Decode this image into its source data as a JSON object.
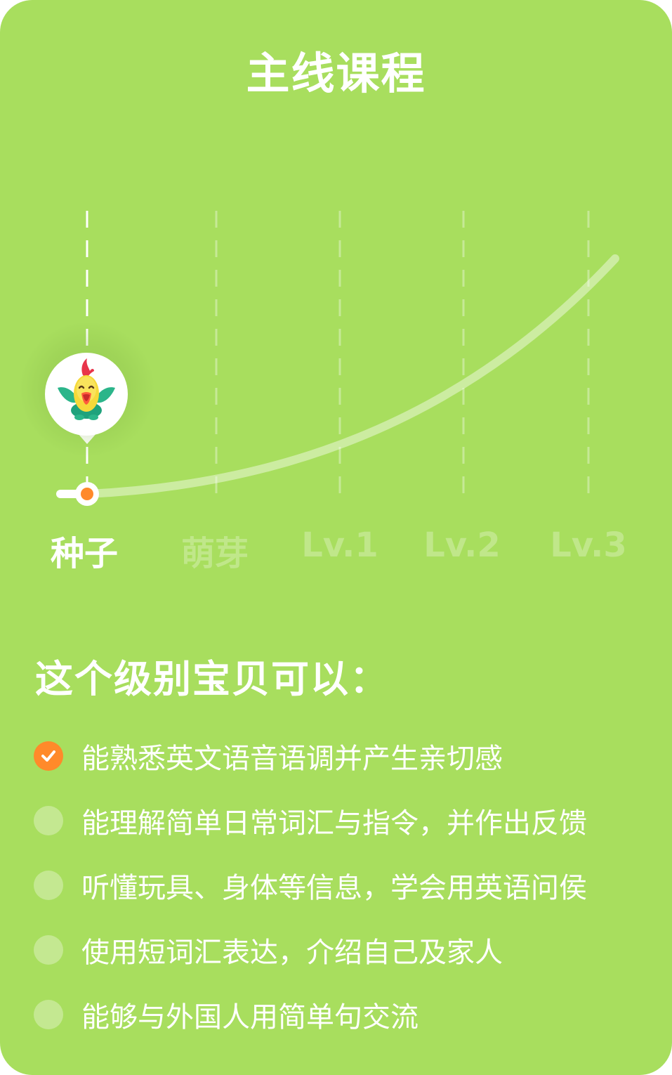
{
  "title": "主线课程",
  "progress": {
    "levels": [
      {
        "label": "种子",
        "current": true
      },
      {
        "label": "萌芽",
        "current": false
      },
      {
        "label": "Lv.1",
        "current": false
      },
      {
        "label": "Lv.2",
        "current": false
      },
      {
        "label": "Lv.3",
        "current": false
      }
    ],
    "avatar_icon": "rooster-mascot-icon"
  },
  "abilities": {
    "heading": "这个级别宝贝可以：",
    "items": [
      {
        "text": "能熟悉英文语音语调并产生亲切感",
        "done": true
      },
      {
        "text": "能理解简单日常词汇与指令，并作出反馈",
        "done": false
      },
      {
        "text": "听懂玩具、身体等信息，学会用英语问侯",
        "done": false
      },
      {
        "text": "使用短词汇表达，介绍自己及家人",
        "done": false
      },
      {
        "text": "能够与外国人用简单句交流",
        "done": false
      }
    ]
  },
  "colors": {
    "background": "#a8de5e",
    "accent": "#ff8a2a",
    "text": "#ffffff"
  }
}
